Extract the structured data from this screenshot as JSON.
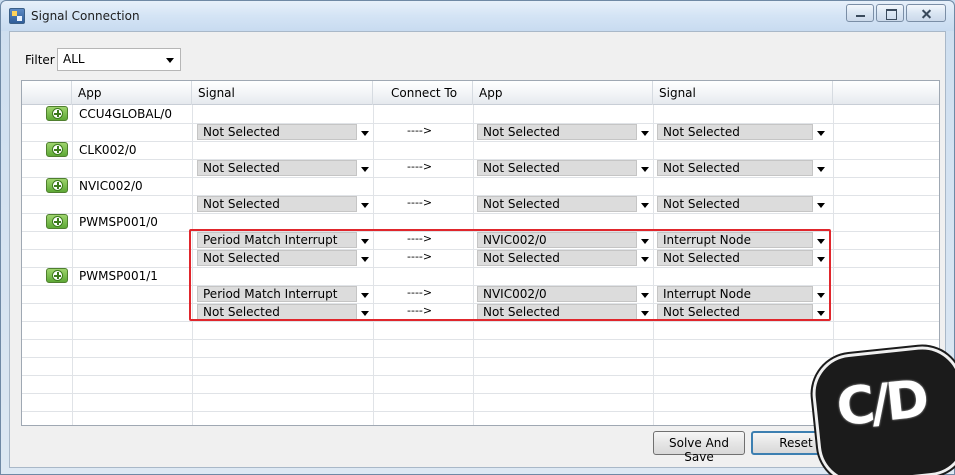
{
  "window": {
    "title": "Signal Connection"
  },
  "filter": {
    "label": "Filter",
    "value": "ALL"
  },
  "columns": [
    "App",
    "Signal",
    "Connect To",
    "App",
    "Signal"
  ],
  "apps": [
    "CCU4GLOBAL/0",
    "CLK002/0",
    "NVIC002/0",
    "PWMSP001/0",
    "PWMSP001/1"
  ],
  "connections": [
    {
      "signal": "Not Selected",
      "arrow": "---->",
      "app": "Not Selected",
      "target": "Not Selected"
    },
    {
      "signal": "Not Selected",
      "arrow": "---->",
      "app": "Not Selected",
      "target": "Not Selected"
    },
    {
      "signal": "Not Selected",
      "arrow": "---->",
      "app": "Not Selected",
      "target": "Not Selected"
    },
    {
      "signal": "Period Match Interrupt",
      "arrow": "---->",
      "app": "NVIC002/0",
      "target": "Interrupt Node"
    },
    {
      "signal": "Not Selected",
      "arrow": "---->",
      "app": "Not Selected",
      "target": "Not Selected"
    },
    {
      "signal": "Period Match Interrupt",
      "arrow": "---->",
      "app": "NVIC002/0",
      "target": "Interrupt Node"
    },
    {
      "signal": "Not Selected",
      "arrow": "---->",
      "app": "Not Selected",
      "target": "Not Selected"
    }
  ],
  "buttons": {
    "solve": "Solve And Save",
    "reset": "Reset"
  },
  "watermark": "C/D",
  "colors": {
    "highlight": "#e0262c",
    "add_button": "#5ea836"
  }
}
